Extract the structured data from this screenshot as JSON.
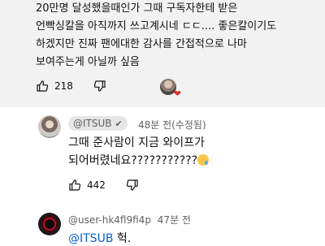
{
  "top_comment": {
    "lines": [
      "20만명 달성했을때인가 그때 구독자한테 받은",
      "언빡싱칼을 아직까지 쓰고계시네 ㄷㄷ.... 좋은칼이기도",
      "하겠지만 진짜 팬에대한 감사를 간접적으로 나마",
      "보여주는게 아닐까 싶음"
    ],
    "like_count": "218"
  },
  "reply_itsub": {
    "channel": "@ITSUB",
    "verified_mark": "✔",
    "time": "48분 전(수정됨)",
    "lines": [
      "그때 준사람이 지금 와이프가",
      "되어버렸네요???????????"
    ],
    "like_count": "442"
  },
  "reply_user": {
    "handle": "@user-hk4fl9fi4p",
    "time": "47분 전",
    "mention": "@ITSUB",
    "text": " 헉."
  },
  "colors": {
    "top_comment_bg": "#f2f2f2",
    "mention": "#065fd4",
    "meta_text": "#606060"
  },
  "icons": [
    "thumb-up-icon",
    "thumb-down-icon",
    "heart-icon",
    "verified-check-icon",
    "sad-emoji-icon"
  ]
}
